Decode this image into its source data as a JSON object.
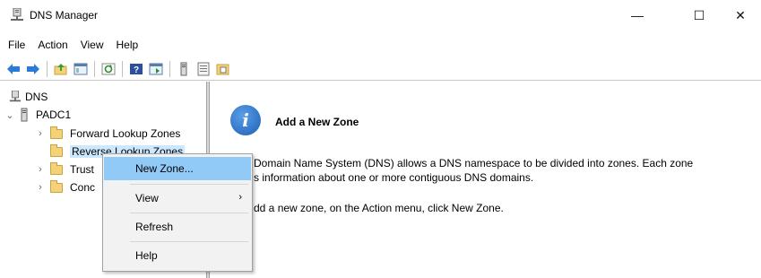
{
  "window": {
    "title": "DNS Manager",
    "controls": {
      "minimize": "—",
      "maximize": "☐",
      "close": "✕"
    }
  },
  "menubar": {
    "items": [
      "File",
      "Action",
      "View",
      "Help"
    ]
  },
  "toolbar": {
    "buttons": [
      "back-icon",
      "forward-icon",
      "up-folder-icon",
      "show-hide-console-tree-icon",
      "refresh-icon",
      "help-icon",
      "properties-icon",
      "server-icon",
      "list-icon",
      "zone-icon"
    ]
  },
  "tree": {
    "root": "DNS",
    "server": "PADC1",
    "items": [
      {
        "label": "Forward Lookup Zones"
      },
      {
        "label": "Reverse Lookup Zones"
      },
      {
        "label": "Trust"
      },
      {
        "label": "Conc"
      }
    ]
  },
  "detail": {
    "heading": "Add a New Zone",
    "line1": "Domain Name System (DNS) allows a DNS namespace to be divided into zones. Each zone",
    "line2": "s information about one or more contiguous DNS domains.",
    "line3": "dd a new zone, on the Action menu, click New Zone."
  },
  "context_menu": {
    "items": [
      {
        "label": "New Zone...",
        "highlighted": true
      },
      {
        "label": "View",
        "submenu": true,
        "arrow": "›"
      },
      {
        "label": "Refresh"
      },
      {
        "label": "Help"
      }
    ]
  }
}
